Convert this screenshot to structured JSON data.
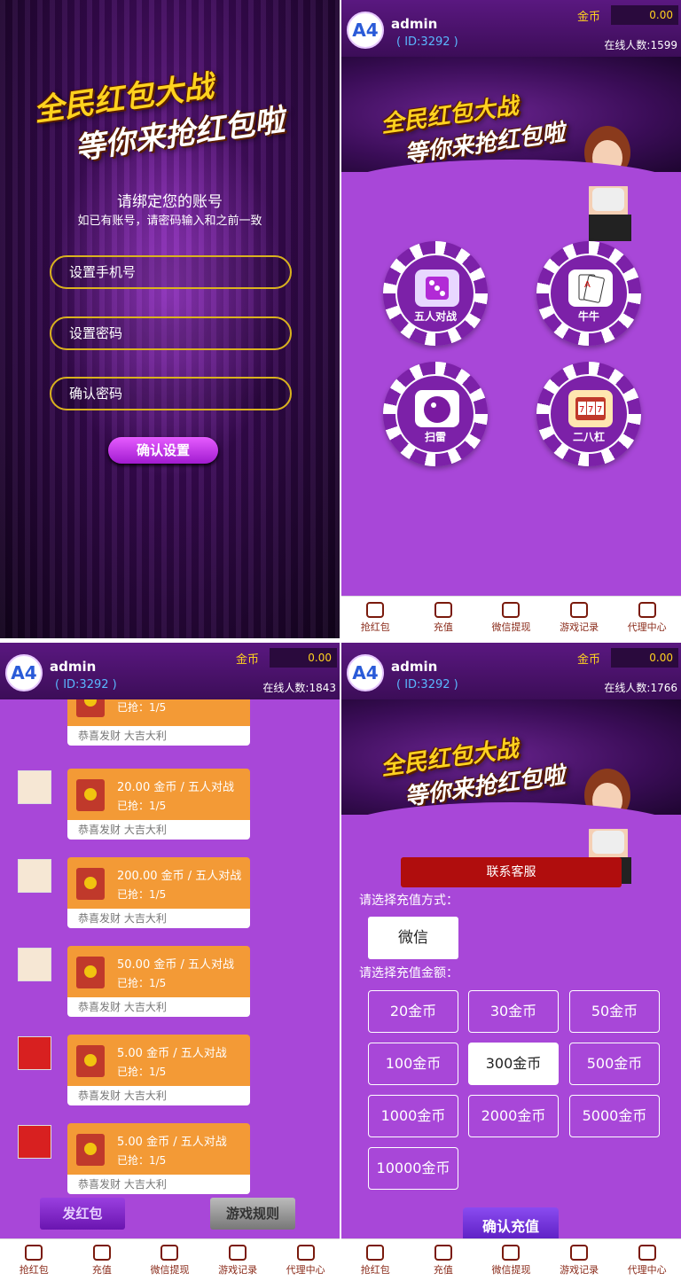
{
  "login": {
    "logo_line1": "全民红包大战",
    "logo_line2": "等你来抢红包啦",
    "bind_title": "请绑定您的账号",
    "bind_hint": "如已有账号，请密码输入和之前一致",
    "phone_placeholder": "设置手机号",
    "password_placeholder": "设置密码",
    "confirm_placeholder": "确认密码",
    "confirm_button": "确认设置"
  },
  "header": {
    "avatar_text": "A4",
    "username": "admin",
    "coin_label": "金币",
    "coin_value": "0.00"
  },
  "screens": [
    {
      "user_id": "( ID:3292 )",
      "online": "在线人数:1599"
    },
    {
      "user_id": "( ID:3292 )",
      "online": "在线人数:1843"
    },
    {
      "user_id": "( ID:3292 )",
      "online": "在线人数:1766"
    }
  ],
  "games": [
    {
      "label": "五人对战",
      "icon": "dice-icon"
    },
    {
      "label": "牛牛",
      "icon": "playing-cards-icon"
    },
    {
      "label": "扫雷",
      "icon": "bomb-ball-icon"
    },
    {
      "label": "二八杠",
      "icon": "slot-machine-icon"
    }
  ],
  "nav": [
    {
      "label": "抢红包",
      "icon": "money-bag-icon"
    },
    {
      "label": "充值",
      "icon": "yen-ticket-icon"
    },
    {
      "label": "微信提现",
      "icon": "gift-box-icon"
    },
    {
      "label": "游戏记录",
      "icon": "grid-list-icon"
    },
    {
      "label": "代理中心",
      "icon": "crown-icon"
    }
  ],
  "packets": [
    {
      "title": "",
      "got": "已抢：1/5",
      "footer": "恭喜发财 大吉大利"
    },
    {
      "title": "20.00 金币 / 五人对战",
      "got": "已抢：1/5",
      "footer": "恭喜发财 大吉大利"
    },
    {
      "title": "200.00 金币 / 五人对战",
      "got": "已抢：1/5",
      "footer": "恭喜发财 大吉大利"
    },
    {
      "title": "50.00 金币 / 五人对战",
      "got": "已抢：1/5",
      "footer": "恭喜发财 大吉大利"
    },
    {
      "title": "5.00 金币 / 五人对战",
      "got": "已抢：1/5",
      "footer": "恭喜发财 大吉大利"
    },
    {
      "title": "5.00 金币 / 五人对战",
      "got": "已抢：1/5",
      "footer": "恭喜发财 大吉大利"
    }
  ],
  "redpacket_page": {
    "send_button": "发红包",
    "rules_button": "游戏规则"
  },
  "recharge": {
    "service_button": "联系客服",
    "method_label": "请选择充值方式：",
    "method": "微信",
    "amount_label": "请选择充值金额：",
    "amounts": [
      "20金币",
      "30金币",
      "50金币",
      "100金币",
      "300金币",
      "500金币",
      "1000金币",
      "2000金币",
      "5000金币",
      "10000金币"
    ],
    "selected": "300金币",
    "confirm_button": "确认充值"
  }
}
